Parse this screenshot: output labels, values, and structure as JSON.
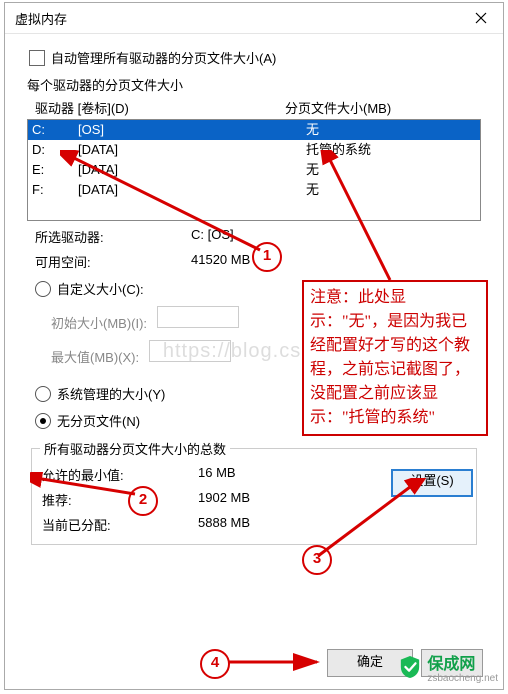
{
  "window": {
    "title": "虚拟内存"
  },
  "auto_manage": {
    "label": "自动管理所有驱动器的分页文件大小(A)",
    "checked": false
  },
  "per_drive_title": "每个驱动器的分页文件大小",
  "columns": {
    "drive": "驱动器  [卷标](D)",
    "page": "分页文件大小(MB)"
  },
  "drives": [
    {
      "letter": "C:",
      "label": "[OS]",
      "page": "无",
      "selected": true
    },
    {
      "letter": "D:",
      "label": "[DATA]",
      "page": "托管的系统",
      "selected": false
    },
    {
      "letter": "E:",
      "label": "[DATA]",
      "page": "无",
      "selected": false
    },
    {
      "letter": "F:",
      "label": "[DATA]",
      "page": "无",
      "selected": false
    }
  ],
  "selected_drive": {
    "label": "所选驱动器:",
    "value": "C:  [OS]"
  },
  "free_space": {
    "label": "可用空间:",
    "value": "41520 MB"
  },
  "radios": {
    "custom": {
      "label": "自定义大小(C):",
      "checked": false
    },
    "system": {
      "label": "系统管理的大小(Y)",
      "checked": false
    },
    "nopage": {
      "label": "无分页文件(N)",
      "checked": true
    }
  },
  "custom_fields": {
    "initial": "初始大小(MB)(I):",
    "max": "最大值(MB)(X):"
  },
  "set_button": "设置(S)",
  "totals": {
    "title": "所有驱动器分页文件大小的总数",
    "min": {
      "label": "允许的最小值:",
      "value": "16 MB"
    },
    "rec": {
      "label": "推荐:",
      "value": "1902 MB"
    },
    "cur": {
      "label": "当前已分配:",
      "value": "5888 MB"
    }
  },
  "buttons": {
    "ok": "确定",
    "cancel": ""
  },
  "annotations": {
    "n1": "1",
    "n2": "2",
    "n3": "3",
    "n4": "4",
    "note": "注意：此处显示：\"无\"，是因为我已经配置好才写的这个教程，之前忘记截图了，没配置之前应该显示：\"托管的系统\""
  },
  "watermark": "https://blog.csdn...",
  "brand": {
    "name": "保成网",
    "domain": "zsbaocheng.net"
  }
}
